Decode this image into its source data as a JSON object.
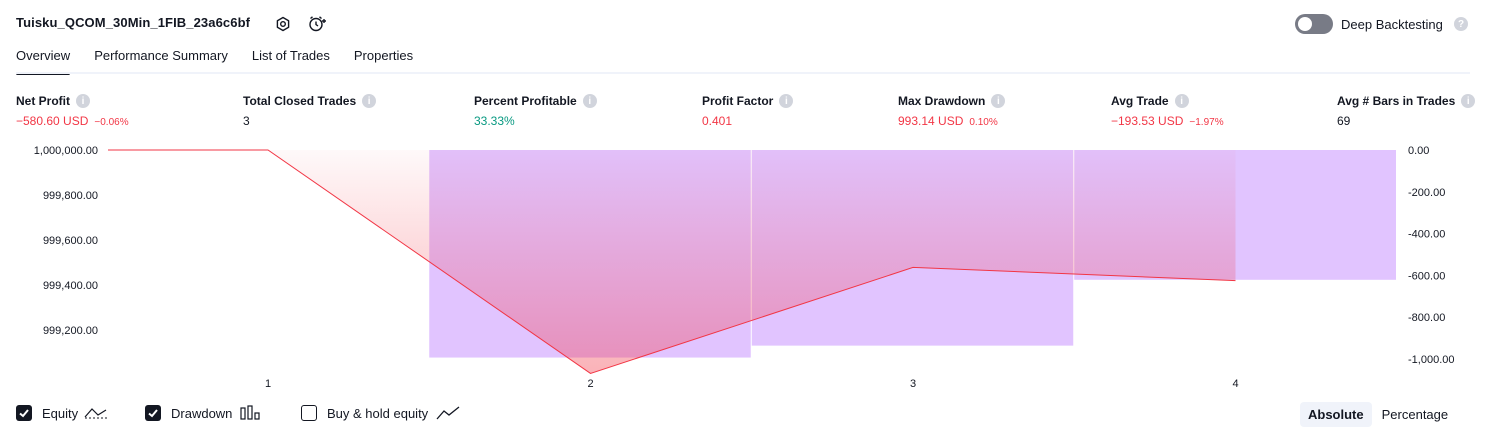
{
  "header": {
    "title": "Tuisku_QCOM_30Min_1FIB_23a6c6bf",
    "deep_backtesting_label": "Deep Backtesting"
  },
  "tabs": [
    {
      "label": "Overview",
      "active": true
    },
    {
      "label": "Performance Summary",
      "active": false
    },
    {
      "label": "List of Trades",
      "active": false
    },
    {
      "label": "Properties",
      "active": false
    }
  ],
  "metrics": [
    {
      "label": "Net Profit",
      "value": "−580.60 USD",
      "sub": "−0.06%",
      "color": "red"
    },
    {
      "label": "Total Closed Trades",
      "value": "3",
      "sub": "",
      "color": "default"
    },
    {
      "label": "Percent Profitable",
      "value": "33.33%",
      "sub": "",
      "color": "green"
    },
    {
      "label": "Profit Factor",
      "value": "0.401",
      "sub": "",
      "color": "red"
    },
    {
      "label": "Max Drawdown",
      "value": "993.14 USD",
      "sub": "0.10%",
      "color": "red"
    },
    {
      "label": "Avg Trade",
      "value": "−193.53 USD",
      "sub": "−1.97%",
      "color": "red"
    },
    {
      "label": "Avg # Bars in Trades",
      "value": "69",
      "sub": "",
      "color": "default"
    }
  ],
  "chart_data": {
    "type": "line",
    "x_labels": [
      "1",
      "2",
      "3",
      "4"
    ],
    "left_axis": {
      "ticks": [
        "1,000,000.00",
        "999,800.00",
        "999,600.00",
        "999,400.00",
        "999,200.00"
      ]
    },
    "right_axis": {
      "ticks": [
        "0.00",
        "-200.00",
        "-400.00",
        "-600.00",
        "-800.00",
        "-1,000.00"
      ]
    },
    "series": [
      {
        "name": "Equity",
        "x": [
          0,
          1,
          2,
          3,
          4
        ],
        "y": [
          1000000,
          1000000,
          999006.86,
          999478.2,
          999419.4
        ],
        "color": "#f23645"
      },
      {
        "name": "Drawdown",
        "x": [
          2,
          3,
          4
        ],
        "y": [
          -993.14,
          -936.0,
          -621.0
        ],
        "color": "#e1c4ff"
      }
    ]
  },
  "legend": [
    {
      "label": "Equity",
      "checked": true,
      "icon": "equity-line-icon"
    },
    {
      "label": "Drawdown",
      "checked": true,
      "icon": "drawdown-bars-icon"
    },
    {
      "label": "Buy & hold equity",
      "checked": false,
      "icon": "buy-hold-line-icon"
    }
  ],
  "view_mode": {
    "options": [
      "Absolute",
      "Percentage"
    ],
    "selected": "Absolute"
  }
}
